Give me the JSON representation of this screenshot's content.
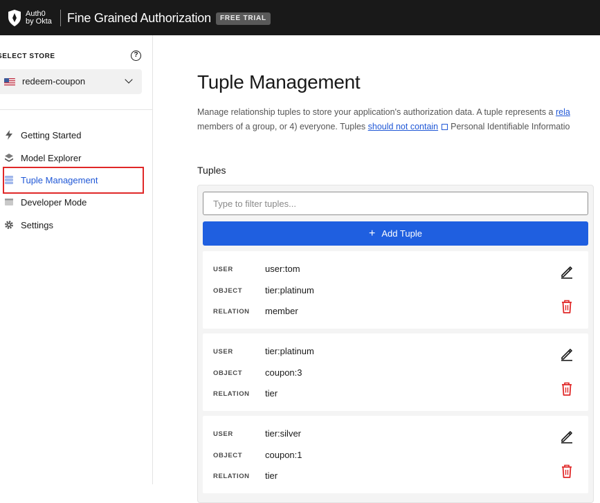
{
  "header": {
    "brand_line1": "Auth0",
    "brand_line2": "by Okta",
    "product_name": "Fine Grained Authorization",
    "trial_badge": "FREE TRIAL"
  },
  "sidebar": {
    "store_label": "SELECT STORE",
    "help_glyph": "?",
    "store_value": "redeem-coupon",
    "items": [
      {
        "label": "Getting Started",
        "icon": "lightning-icon"
      },
      {
        "label": "Model Explorer",
        "icon": "layers-icon"
      },
      {
        "label": "Tuple Management",
        "icon": "database-icon",
        "active": true
      },
      {
        "label": "Developer Mode",
        "icon": "terminal-icon"
      },
      {
        "label": "Settings",
        "icon": "gear-icon"
      }
    ]
  },
  "main": {
    "title": "Tuple Management",
    "description_line1_a": "Manage relationship tuples to store your application's authorization data. A tuple represents a ",
    "description_line1_link": "rela",
    "description_line2_a": "members of a group, or 4) everyone. Tuples ",
    "description_line2_link": "should not contain",
    "description_line2_b": "Personal Identifiable Informatio",
    "section_title": "Tuples",
    "filter_placeholder": "Type to filter tuples...",
    "add_button_label": "Add Tuple",
    "field_labels": {
      "user": "USER",
      "object": "OBJECT",
      "relation": "RELATION"
    },
    "tuples": [
      {
        "user": "user:tom",
        "object": "tier:platinum",
        "relation": "member"
      },
      {
        "user": "tier:platinum",
        "object": "coupon:3",
        "relation": "tier"
      },
      {
        "user": "tier:silver",
        "object": "coupon:1",
        "relation": "tier"
      }
    ]
  },
  "colors": {
    "topbar": "#191919",
    "accent": "#1f5fe0",
    "active_link": "#1f57d6",
    "delete": "#e02727",
    "highlight": "#e02727"
  }
}
